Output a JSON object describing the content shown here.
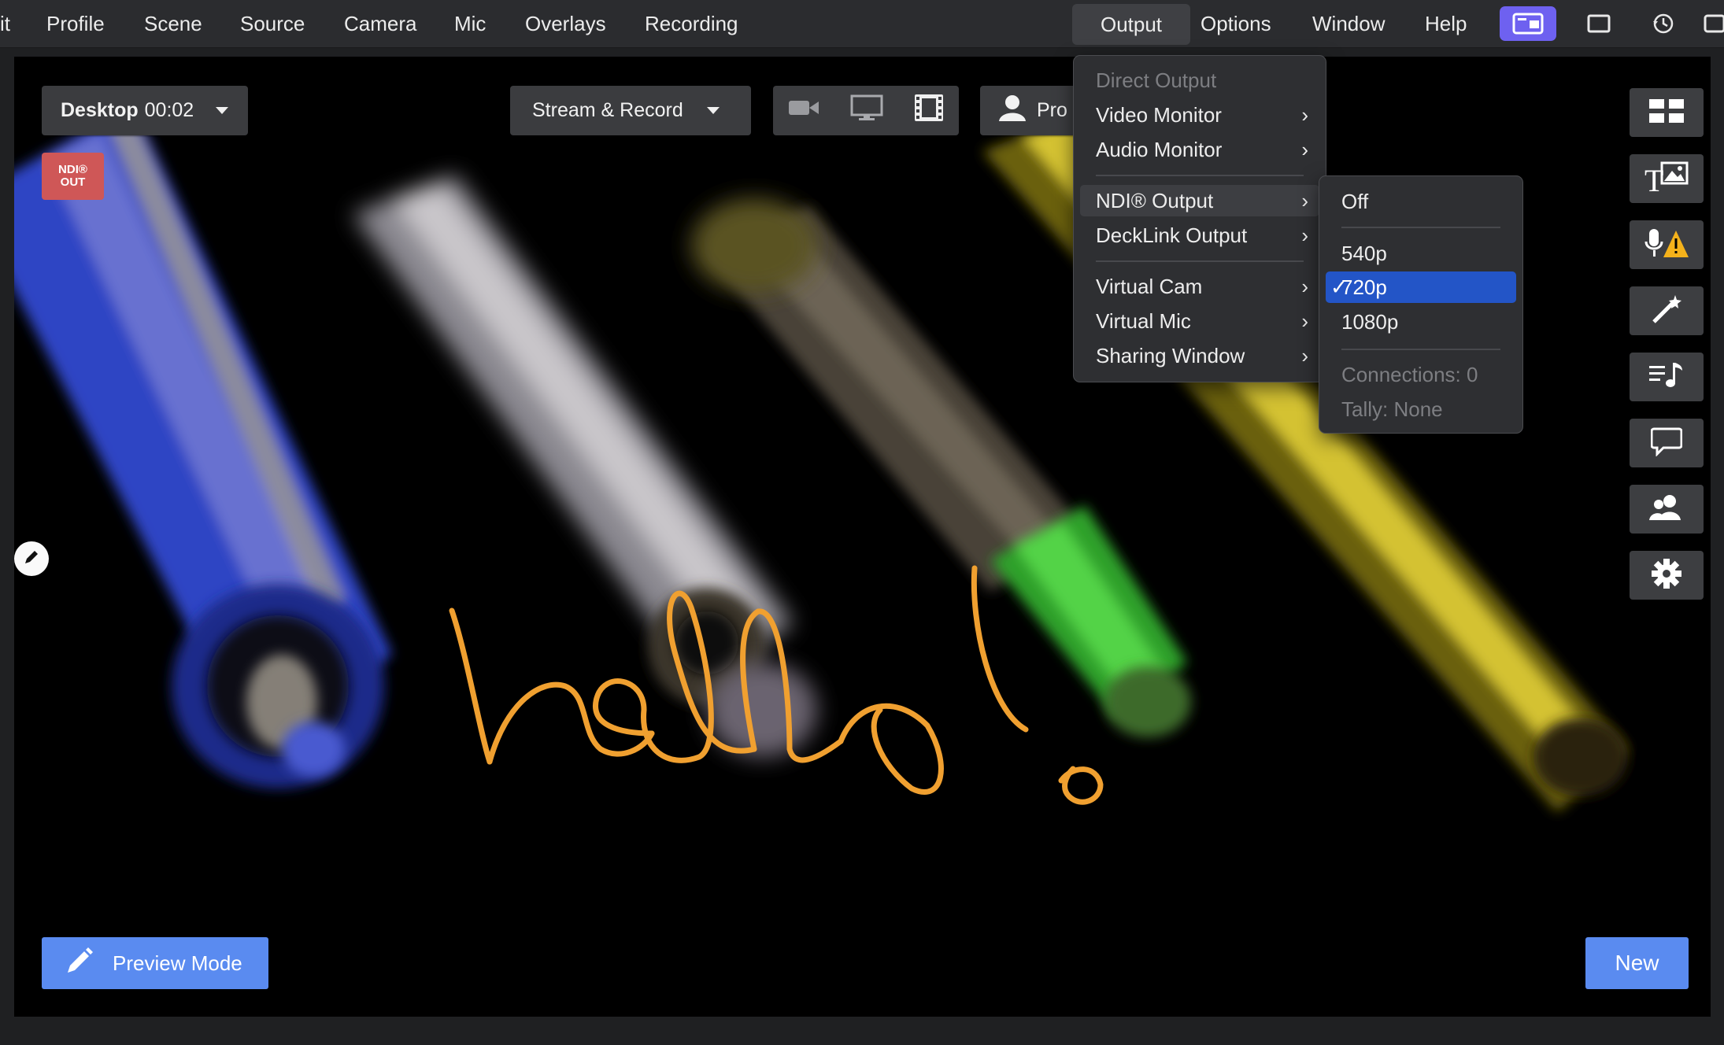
{
  "menubar": {
    "items": [
      "it",
      "Profile",
      "Scene",
      "Source",
      "Camera",
      "Mic",
      "Overlays",
      "Recording",
      "Output",
      "Options",
      "Window",
      "Help"
    ],
    "active": "Output"
  },
  "toolbar": {
    "scene_label": "Desktop",
    "scene_time": "00:02",
    "stream_mode": "Stream & Record",
    "profile_label_partial": "Pro"
  },
  "badge": {
    "line1": "NDI®",
    "line2": "OUT"
  },
  "output_menu": {
    "items": [
      {
        "label": "Direct Output",
        "disabled": true,
        "submenu": false
      },
      {
        "label": "Video Monitor",
        "disabled": false,
        "submenu": true
      },
      {
        "label": "Audio Monitor",
        "disabled": false,
        "submenu": true
      },
      {
        "label": "NDI® Output",
        "disabled": false,
        "submenu": true,
        "hover": true
      },
      {
        "label": "DeckLink Output",
        "disabled": false,
        "submenu": true
      },
      {
        "label": "Virtual Cam",
        "disabled": false,
        "submenu": true
      },
      {
        "label": "Virtual Mic",
        "disabled": false,
        "submenu": true
      },
      {
        "label": "Sharing Window",
        "disabled": false,
        "submenu": true
      }
    ]
  },
  "ndi_submenu": {
    "items": [
      {
        "label": "Off"
      },
      {
        "label": "540p"
      },
      {
        "label": "720p",
        "checked": true
      },
      {
        "label": "1080p"
      },
      {
        "label": "Connections: 0",
        "disabled": true
      },
      {
        "label": "Tally: None",
        "disabled": true
      }
    ],
    "check_glyph": "✓"
  },
  "sidebar_icons": [
    "layout-grid-icon",
    "text-image-icon",
    "mic-warning-icon",
    "magic-wand-icon",
    "playlist-music-icon",
    "chat-bubble-icon",
    "guests-icon",
    "gear-icon"
  ],
  "buttons": {
    "preview_mode": "Preview Mode",
    "new": "New"
  },
  "colors": {
    "accent": "#5a8bf0",
    "menu_selected": "#2355c7",
    "highlight_icon_bg": "#6e61f0",
    "ndi_badge": "#cf5757",
    "ink": "#f0a030"
  }
}
